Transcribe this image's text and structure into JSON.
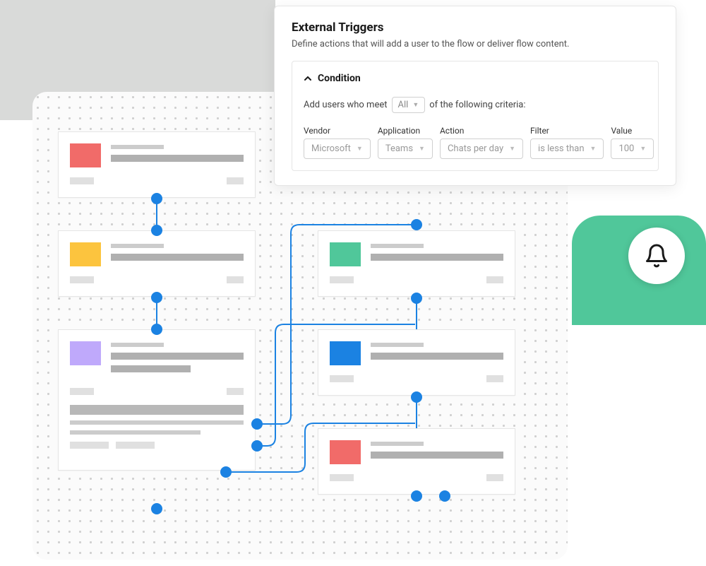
{
  "panel": {
    "title": "External Triggers",
    "subtitle": "Define actions that will add a user to the flow or deliver flow content.",
    "conditionLabel": "Condition",
    "sentence": {
      "prefix": "Add users who meet",
      "allSelect": "All",
      "suffix": "of the following criteria:"
    },
    "fields": {
      "vendor": {
        "label": "Vendor",
        "value": "Microsoft"
      },
      "application": {
        "label": "Application",
        "value": "Teams"
      },
      "action": {
        "label": "Action",
        "value": "Chats per day"
      },
      "filter": {
        "label": "Filter",
        "value": "is less than"
      },
      "value": {
        "label": "Value",
        "value": "100"
      }
    }
  },
  "cards": {
    "c1": {
      "color": "red"
    },
    "c2": {
      "color": "yellow"
    },
    "c3": {
      "color": "purple"
    },
    "c4": {
      "color": "green"
    },
    "c5": {
      "color": "blue"
    },
    "c6": {
      "color": "red"
    }
  },
  "notification": {
    "icon": "bell"
  }
}
